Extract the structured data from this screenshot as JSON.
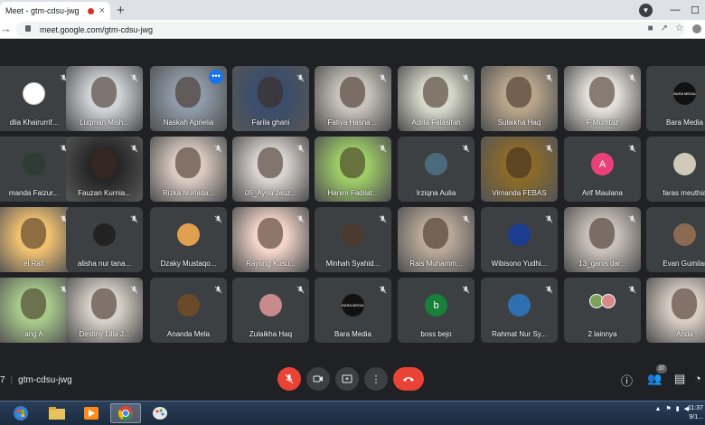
{
  "browser": {
    "tab_title": "Meet - gtm-cdsu-jwg",
    "tab_close": "×",
    "new_tab": "+",
    "url": "meet.google.com/gtm-cdsu-jwg"
  },
  "participants": [
    {
      "name": "dlia Khairurrif...",
      "kind": "avatar",
      "color": "#fff"
    },
    {
      "name": "Luqman Mish...",
      "kind": "video",
      "color": "#cfd3d6"
    },
    {
      "name": "Naskah Aprielia",
      "kind": "video",
      "color": "#8e9aa8",
      "active": true
    },
    {
      "name": "Farila ghani",
      "kind": "video",
      "color": "#3a4d6b"
    },
    {
      "name": "Fatiya Hasna ...",
      "kind": "video",
      "color": "#c7c2bb"
    },
    {
      "name": "Adilla Falasifah",
      "kind": "video",
      "color": "#d5d8c9"
    },
    {
      "name": "Sulaikha Haq",
      "kind": "video",
      "color": "#b9a58a"
    },
    {
      "name": "F Mumtaz",
      "kind": "video",
      "color": "#e3dfd9"
    },
    {
      "name": "Bara Media",
      "kind": "avatar",
      "color": "#111"
    },
    {
      "name": "manda Faizur...",
      "kind": "avatar",
      "color": "#2f3b35"
    },
    {
      "name": "Fauzan Kurnia...",
      "kind": "video",
      "color": "#262626"
    },
    {
      "name": "Rizka Nurhida...",
      "kind": "video",
      "color": "#d9c9c0"
    },
    {
      "name": "05_Ayna Jauz...",
      "kind": "video",
      "color": "#d8d3cf"
    },
    {
      "name": "Hanim Fadilat...",
      "kind": "video",
      "color": "#9ccc65"
    },
    {
      "name": "Irziqna Aulia",
      "kind": "avatar",
      "color": "#4d6a7c"
    },
    {
      "name": "Virnanda FEBAS",
      "kind": "video",
      "color": "#8a6a2a"
    },
    {
      "name": "Arif Maulana",
      "kind": "letter",
      "letter": "A",
      "color": "#ec407a"
    },
    {
      "name": "faras meuthia",
      "kind": "avatar",
      "color": "#d0c8b8"
    },
    {
      "name": "el Rafi",
      "kind": "video",
      "color": "#f0c070"
    },
    {
      "name": "alisha nur tana...",
      "kind": "avatar",
      "color": "#222"
    },
    {
      "name": "Dzaky Mustaqo...",
      "kind": "avatar",
      "color": "#e0a050"
    },
    {
      "name": "Rayung Kusu...",
      "kind": "video",
      "color": "#f3d4c9"
    },
    {
      "name": "Minhah Syahid...",
      "kind": "avatar",
      "color": "#4a3a30"
    },
    {
      "name": "Rais Muhamm...",
      "kind": "video",
      "color": "#b8a898"
    },
    {
      "name": "Wibisono Yudhi...",
      "kind": "avatar",
      "color": "#1c3d8f"
    },
    {
      "name": "13_ganis dar...",
      "kind": "video",
      "color": "#c8c0b8"
    },
    {
      "name": "Evan Gumilar",
      "kind": "avatar",
      "color": "#8a6a50"
    },
    {
      "name": "ang A",
      "kind": "video",
      "color": "#a6c98a"
    },
    {
      "name": "Destiny Lilla J...",
      "kind": "video",
      "color": "#d6cfc5"
    },
    {
      "name": "Ananda Mela",
      "kind": "avatar",
      "color": "#6b4a2a"
    },
    {
      "name": "Zulaikha Haq",
      "kind": "avatar",
      "color": "#c88a8a"
    },
    {
      "name": "Bara Media",
      "kind": "avatar",
      "color": "#111"
    },
    {
      "name": "boss bejo",
      "kind": "letter",
      "letter": "b",
      "color": "#188038"
    },
    {
      "name": "Rahmat Nur Sy...",
      "kind": "avatar",
      "color": "#2f6fb0"
    },
    {
      "name": "2 lainnya",
      "kind": "more",
      "color": "#3c4043"
    },
    {
      "name": "Anda",
      "kind": "video",
      "color": "#d8ccc2"
    }
  ],
  "avatar_texts": {
    "bara_media": "BARA MEDIA"
  },
  "controls": {
    "left_number": "7",
    "meeting_code": "gtm-cdsu-jwg",
    "participant_count": "37"
  },
  "taskbar": {
    "time": "11:37",
    "date": "9/1..."
  }
}
